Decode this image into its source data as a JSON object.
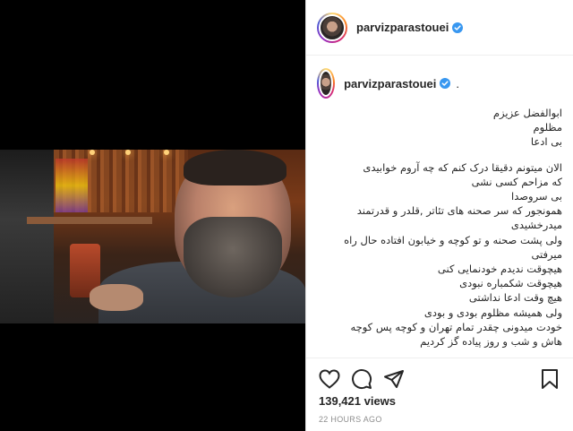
{
  "post": {
    "username": "parvizparastouei",
    "comment_dot": ".",
    "caption_lines": [
      "ابوالفضل عزیزم",
      "مظلوم",
      "بی ادعا",
      "",
      "الان میتونم دقیقا درک کنم که چه آروم خوابیدی",
      "که مزاحم کسی نشی",
      "بی سروصدا",
      "همونجور که سر صحنه های تئاتر ,قلدر و قدرتمند",
      "میدرخشیدی",
      "ولی پشت صحنه و تو کوچه و خیابون افتاده حال راه",
      "میرفتی",
      "هیچوقت ندیدم خودنمایی کنی",
      "هیچوقت شکمباره نبودی",
      "هیچ وقت ادعا نداشتی",
      "ولی همیشه مظلوم بودی و بودی",
      "خودت میدونی چقدر تمام تهران و کوچه پس کوچه",
      "هاش و شب و روز پیاده گز کردیم"
    ],
    "views": "139,421 views",
    "timestamp": "22 HOURS AGO"
  },
  "icons": {
    "verified": "verified-badge-icon",
    "like": "heart-icon",
    "comment": "comment-icon",
    "share": "paper-plane-icon",
    "save": "bookmark-icon"
  },
  "colors": {
    "verified": "#3897f0",
    "text": "#262626",
    "muted": "#8e8e8e"
  }
}
